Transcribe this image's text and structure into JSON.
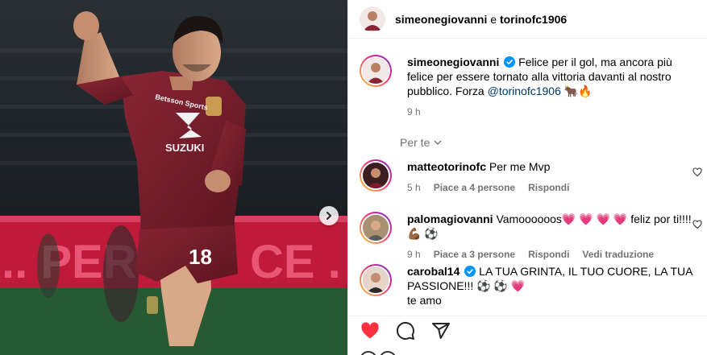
{
  "header": {
    "author": "simeonegiovanni",
    "joiner": "e",
    "collaborator": "torinofc1906"
  },
  "caption": {
    "username": "simeonegiovanni",
    "text": "Felice per il gol, ma ancora più felice per essere tornato alla vittoria davanti al nostro pubblico. Forza",
    "mention": "@torinofc1906",
    "emoji": "🐂🔥",
    "time": "9 h"
  },
  "filter": {
    "label": "Per te"
  },
  "comments": [
    {
      "username": "matteotorinofc",
      "text": "Per me Mvp",
      "time": "5 h",
      "likes": "Piace a 4 persone",
      "reply": "Rispondi",
      "translate": ""
    },
    {
      "username": "palomagiovanni",
      "text": "Vamoooooos💗 💗 💗 💗  feliz por ti!!!! 💪🏾 ⚽",
      "time": "9 h",
      "likes": "Piace a 3 persone",
      "reply": "Rispondi",
      "translate": "Vedi traduzione"
    },
    {
      "username": "carobal14",
      "text": "LA TUA GRINTA, IL TUO CUORE, LA TUA PASSIONE!!! ⚽ ⚽ 💗",
      "text2": "te amo",
      "time": "",
      "likes": "",
      "reply": "",
      "translate": ""
    }
  ],
  "player": {
    "shirt_number": "18",
    "sponsor": "SUZUKI",
    "sleeve_text": "Betsson Sports"
  },
  "colors": {
    "accent_red": "#ff3040",
    "link_blue": "#00376b",
    "meta_gray": "#737373",
    "verified_blue": "#0095f6",
    "jersey": "#7a1f2b"
  },
  "icons": [
    "heart-icon",
    "comment-icon",
    "share-icon",
    "verified-icon",
    "chevron-down-icon",
    "next-arrow-icon"
  ]
}
